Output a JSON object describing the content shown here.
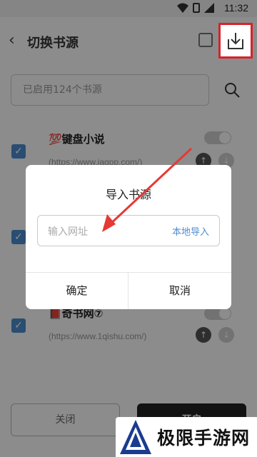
{
  "status_bar": {
    "time": "11:32"
  },
  "header": {
    "back_icon": "back-arrow-icon",
    "title": "切换书源",
    "import_icon": "download-icon"
  },
  "search": {
    "placeholder": "已启用124个书源"
  },
  "sources": [
    {
      "name": "💯键盘小说",
      "url": "(https://www.jagpp.com/)"
    },
    {
      "name": "",
      "url": ""
    },
    {
      "name": "📕奇书网⑦",
      "url": "(https://www.1qishu.com/)"
    }
  ],
  "footer": {
    "close_label": "关闭",
    "enable_label": "开启"
  },
  "dialog": {
    "title": "导入书源",
    "url_placeholder": "输入网址",
    "local_import_label": "本地导入",
    "confirm_label": "确定",
    "cancel_label": "取消"
  },
  "watermark": {
    "text": "极限手游网"
  },
  "colors": {
    "accent": "#4d8cd0",
    "highlight": "#d9222a",
    "annotation_arrow": "#e53935"
  }
}
